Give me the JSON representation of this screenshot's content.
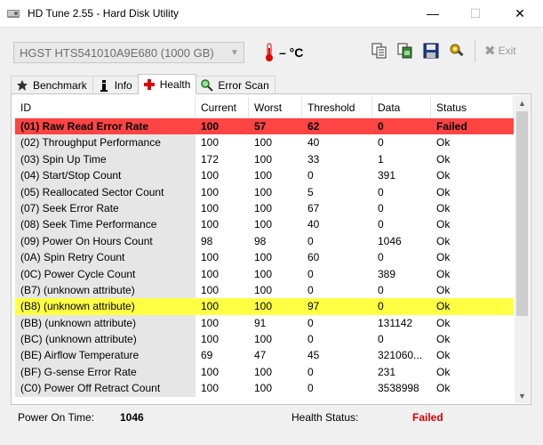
{
  "window": {
    "title": "HD Tune 2.55 - Hard Disk Utility",
    "min_glyph": "—",
    "max_glyph": "☐",
    "close_glyph": "✕"
  },
  "toolbar": {
    "drive": "HGST   HTS541010A9E680 (1000 GB)",
    "temperature": "– °C",
    "exit_label": "Exit",
    "icons": [
      "copy-text-icon",
      "copy-screenshot-icon",
      "save-icon",
      "options-icon"
    ]
  },
  "tabs": [
    {
      "label": "Benchmark",
      "icon": "benchmark-icon"
    },
    {
      "label": "Info",
      "icon": "info-icon"
    },
    {
      "label": "Health",
      "icon": "health-cross-icon",
      "active": true
    },
    {
      "label": "Error Scan",
      "icon": "magnifier-icon"
    }
  ],
  "table": {
    "columns": [
      "ID",
      "Current",
      "Worst",
      "Threshold",
      "Data",
      "Status"
    ],
    "rows": [
      {
        "id": "(01) Raw Read Error Rate",
        "current": "100",
        "worst": "57",
        "threshold": "62",
        "data": "0",
        "status": "Failed",
        "state": "failed"
      },
      {
        "id": "(02) Throughput Performance",
        "current": "100",
        "worst": "100",
        "threshold": "40",
        "data": "0",
        "status": "Ok"
      },
      {
        "id": "(03) Spin Up Time",
        "current": "172",
        "worst": "100",
        "threshold": "33",
        "data": "1",
        "status": "Ok"
      },
      {
        "id": "(04) Start/Stop Count",
        "current": "100",
        "worst": "100",
        "threshold": "0",
        "data": "391",
        "status": "Ok"
      },
      {
        "id": "(05) Reallocated Sector Count",
        "current": "100",
        "worst": "100",
        "threshold": "5",
        "data": "0",
        "status": "Ok"
      },
      {
        "id": "(07) Seek Error Rate",
        "current": "100",
        "worst": "100",
        "threshold": "67",
        "data": "0",
        "status": "Ok"
      },
      {
        "id": "(08) Seek Time Performance",
        "current": "100",
        "worst": "100",
        "threshold": "40",
        "data": "0",
        "status": "Ok"
      },
      {
        "id": "(09) Power On Hours Count",
        "current": "98",
        "worst": "98",
        "threshold": "0",
        "data": "1046",
        "status": "Ok"
      },
      {
        "id": "(0A) Spin Retry Count",
        "current": "100",
        "worst": "100",
        "threshold": "60",
        "data": "0",
        "status": "Ok"
      },
      {
        "id": "(0C) Power Cycle Count",
        "current": "100",
        "worst": "100",
        "threshold": "0",
        "data": "389",
        "status": "Ok"
      },
      {
        "id": "(B7) (unknown attribute)",
        "current": "100",
        "worst": "100",
        "threshold": "0",
        "data": "0",
        "status": "Ok"
      },
      {
        "id": "(B8) (unknown attribute)",
        "current": "100",
        "worst": "100",
        "threshold": "97",
        "data": "0",
        "status": "Ok",
        "state": "warn"
      },
      {
        "id": "(BB) (unknown attribute)",
        "current": "100",
        "worst": "91",
        "threshold": "0",
        "data": "131142",
        "status": "Ok"
      },
      {
        "id": "(BC) (unknown attribute)",
        "current": "100",
        "worst": "100",
        "threshold": "0",
        "data": "0",
        "status": "Ok"
      },
      {
        "id": "(BE) Airflow Temperature",
        "current": "69",
        "worst": "47",
        "threshold": "45",
        "data": "321060...",
        "status": "Ok"
      },
      {
        "id": "(BF) G-sense Error Rate",
        "current": "100",
        "worst": "100",
        "threshold": "0",
        "data": "231",
        "status": "Ok"
      },
      {
        "id": "(C0) Power Off Retract Count",
        "current": "100",
        "worst": "100",
        "threshold": "0",
        "data": "3538998",
        "status": "Ok"
      }
    ]
  },
  "statusbar": {
    "power_on_label": "Power On Time:",
    "power_on_value": "1046",
    "health_label": "Health Status:",
    "health_value": "Failed"
  },
  "colors": {
    "failed_row": "#ff4444",
    "warn_row": "#ffff44",
    "failed_text": "#d40000"
  }
}
